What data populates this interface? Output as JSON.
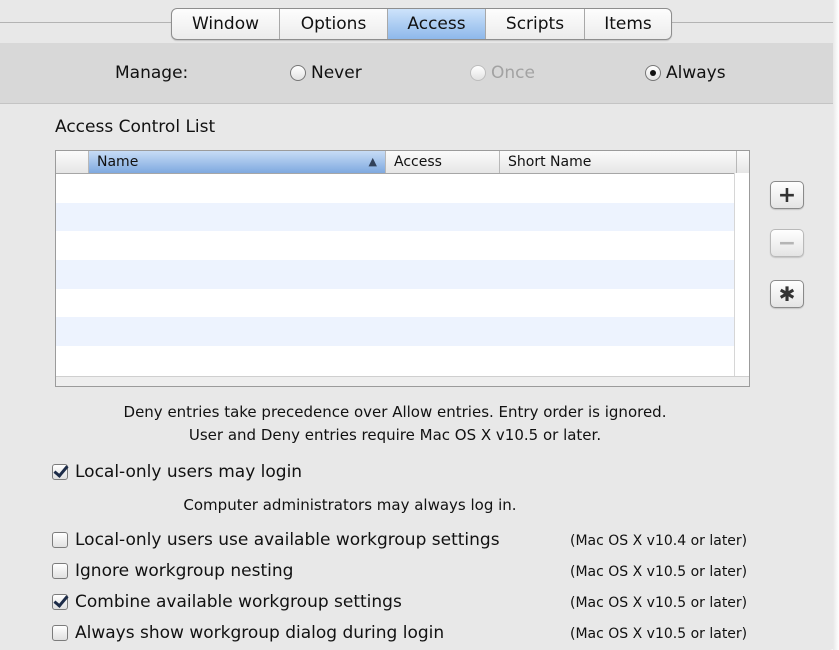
{
  "tabs": [
    {
      "label": "Window",
      "active": false
    },
    {
      "label": "Options",
      "active": false
    },
    {
      "label": "Access",
      "active": true
    },
    {
      "label": "Scripts",
      "active": false
    },
    {
      "label": "Items",
      "active": false
    }
  ],
  "manage": {
    "label": "Manage:",
    "options": [
      {
        "label": "Never",
        "selected": false,
        "enabled": true
      },
      {
        "label": "Once",
        "selected": false,
        "enabled": false
      },
      {
        "label": "Always",
        "selected": true,
        "enabled": true
      }
    ]
  },
  "acl": {
    "title": "Access Control List",
    "columns": [
      "Name",
      "Access",
      "Short Name"
    ],
    "sorted_column": "Name",
    "rows": []
  },
  "buttons": {
    "add": "+",
    "remove": "−",
    "action": "✱"
  },
  "notes": {
    "line1": "Deny entries take precedence over Allow entries. Entry order is ignored.",
    "line2": "User and Deny entries require Mac OS X v10.5 or later.",
    "admin": "Computer administrators may always log in."
  },
  "options": {
    "local_login": {
      "label": "Local-only users may login",
      "checked": true
    },
    "local_workgroup": {
      "label": "Local-only users use available workgroup settings",
      "checked": false,
      "requirement": "(Mac OS X v10.4 or later)"
    },
    "ignore_nesting": {
      "label": "Ignore workgroup nesting",
      "checked": false,
      "requirement": "(Mac OS X v10.5 or later)"
    },
    "combine": {
      "label": "Combine available workgroup settings",
      "checked": true,
      "requirement": "(Mac OS X v10.5 or later)"
    },
    "show_dialog": {
      "label": "Always show workgroup dialog during login",
      "checked": false,
      "requirement": "(Mac OS X v10.5 or later)"
    }
  },
  "colors": {
    "selected_tab": "#8eb8ea",
    "row_stripe": "#edf3fe",
    "panel": "#e8e8e8"
  }
}
